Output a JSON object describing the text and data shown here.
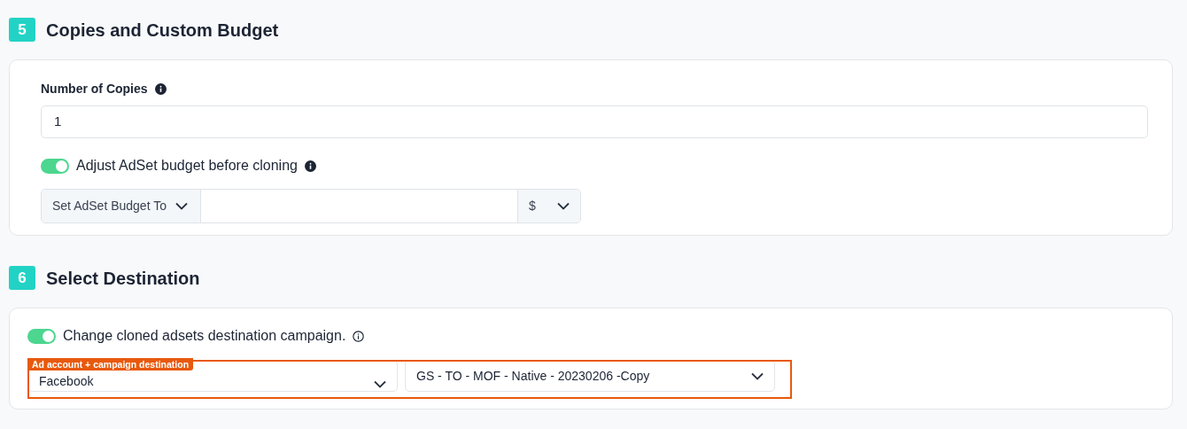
{
  "sections": [
    {
      "number": "5",
      "title": "Copies and Custom Budget",
      "copies": {
        "label": "Number of Copies",
        "value": "1"
      },
      "budget_toggle": {
        "label": "Adjust AdSet budget before cloning",
        "on": true
      },
      "budget_mode": "Set AdSet Budget To",
      "currency": "$"
    },
    {
      "number": "6",
      "title": "Select Destination",
      "destination_toggle": {
        "label": "Change cloned adsets destination campaign.",
        "on": true
      },
      "account": "Facebook",
      "campaign": "GS - TO - MOF - Native - 20230206 -Copy",
      "annotation": "Ad account + campaign destination"
    }
  ]
}
